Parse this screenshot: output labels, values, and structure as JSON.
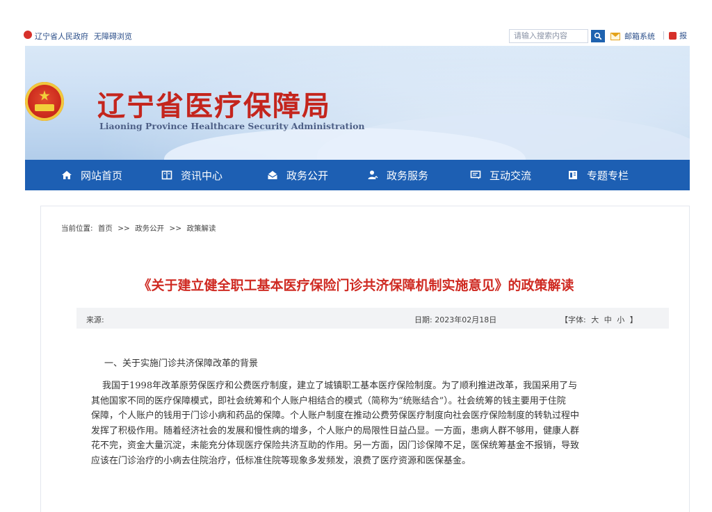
{
  "topbar": {
    "gov_name": "辽宁省人民政府",
    "accessibility": "无障碍浏览",
    "search_placeholder": "请输入搜索内容",
    "mail": "邮箱系统",
    "report_partial": "报"
  },
  "banner": {
    "title": "辽宁省医疗保障局",
    "subtitle": "Liaoning Province Healthcare Security Administration"
  },
  "nav": {
    "items": [
      {
        "label": "网站首页",
        "icon": "home-icon"
      },
      {
        "label": "资讯中心",
        "icon": "news-icon"
      },
      {
        "label": "政务公开",
        "icon": "envelope-open-icon"
      },
      {
        "label": "政务服务",
        "icon": "user-service-icon"
      },
      {
        "label": "互动交流",
        "icon": "chat-icon"
      },
      {
        "label": "专题专栏",
        "icon": "book-icon"
      }
    ]
  },
  "breadcrumb": {
    "prefix": "当前位置:",
    "items": [
      "首页",
      "政务公开",
      "政策解读"
    ],
    "separator": ">>"
  },
  "article": {
    "title": "《关于建立健全职工基本医疗保险门诊共济保障机制实施意见》的政策解读",
    "source_label": "来源:",
    "date_label": "日期:",
    "date": "2023年02月18日",
    "font_label": "【字体:",
    "font_large": "大",
    "font_medium": "中",
    "font_small": "小",
    "font_close": "】",
    "section_heading": "一、关于实施门诊共济保障改革的背景",
    "paragraph_lines": [
      "我国于1998年改革原劳保医疗和公费医疗制度，建立了城镇职工基本医疗保险制度。为了顺利推进改革，我国采用了与",
      "其他国家不同的医疗保障模式，即社会统筹和个人账户相结合的模式（简称为“统账结合”）。社会统筹的钱主要用于住院",
      "保障，个人账户的钱用于门诊小病和药品的保障。个人账户制度在推动公费劳保医疗制度向社会医疗保险制度的转轨过程中",
      "发挥了积极作用。随着经济社会的发展和慢性病的增多，个人账户的局限性日益凸显。一方面，患病人群不够用，健康人群",
      "花不完，资金大量沉淀，未能充分体现医疗保险共济互助的作用。另一方面，因门诊保障不足，医保统筹基金不报销，导致",
      "应该在门诊治疗的小病去住院治疗，低标准住院等现象多发频发，浪费了医疗资源和医保基金。"
    ]
  },
  "colors": {
    "nav_blue": "#1d5fb3",
    "title_red": "#cf2a22",
    "banner_red": "#c4251d"
  }
}
